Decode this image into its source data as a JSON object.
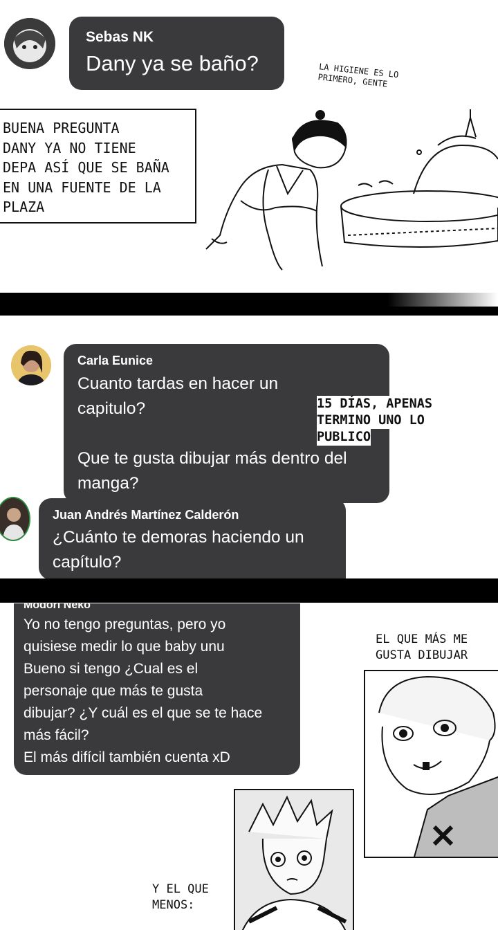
{
  "comments": [
    {
      "author": "Sebas NK",
      "lines": [
        "Dany ya se baño?"
      ]
    },
    {
      "author": "Carla Eunice",
      "lines": [
        "Cuanto tardas en hacer un",
        "capitulo?",
        "",
        "Que te gusta dibujar más dentro del",
        "manga?"
      ]
    },
    {
      "author": "Juan Andrés Martínez Calderón",
      "lines": [
        "¿Cuánto te demoras haciendo un",
        "capítulo?"
      ]
    },
    {
      "author": "Modori Neko",
      "lines": [
        "Yo no tengo preguntas, pero yo",
        "quisiese medir lo que baby unu",
        "Bueno si tengo ¿Cual es el",
        "personaje que más te gusta",
        "dibujar? ¿Y cuál es el que se te hace",
        "más fácil?",
        "El más difícil también cuenta xD"
      ]
    }
  ],
  "answers": {
    "hygiene_note": [
      "LA HIGIENE ES LO",
      "PRIMERO, GENTE"
    ],
    "bath_answer": [
      "BUENA PREGUNTA",
      "DANY YA NO TIENE",
      "DEPA ASÍ QUE SE BAÑA",
      "EN UNA FUENTE DE LA",
      "PLAZA"
    ],
    "time_answer": [
      "15 DÍAS, APENAS",
      "TERMINO UNO LO",
      "PUBLICO"
    ],
    "favorite_label": [
      "EL QUE MÁS ME",
      "GUSTA DIBUJAR"
    ],
    "least_label": [
      "Y EL QUE",
      "MENOS:"
    ]
  },
  "icons": [
    "avatar-sebas",
    "avatar-carla",
    "avatar-juan",
    "character-drawing"
  ]
}
